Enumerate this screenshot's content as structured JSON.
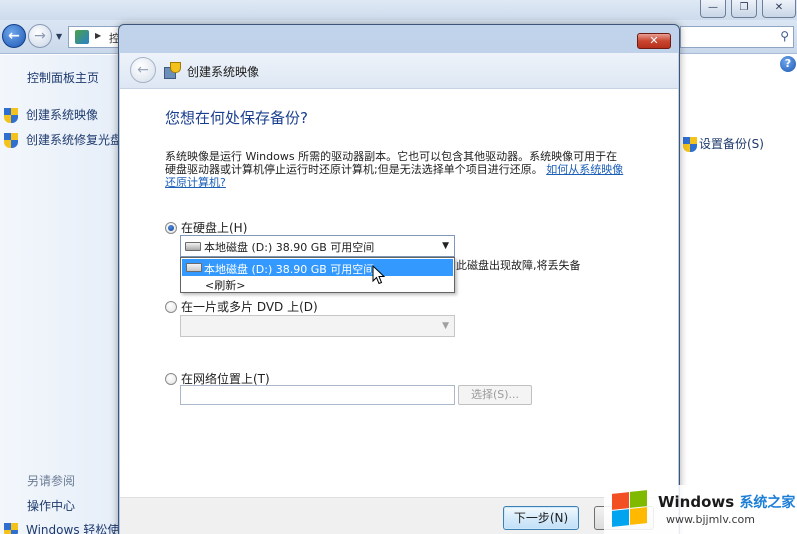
{
  "background": {
    "address_text": "控",
    "sidebar": {
      "home": "控制面板主页",
      "items": [
        "创建系统映像",
        "创建系统修复光盘"
      ],
      "see_also": "另请参阅",
      "links": [
        "操作中心",
        "Windows 轻松使"
      ]
    },
    "setup_backup": "设置备份(S)"
  },
  "dialog": {
    "title": "创建系统映像",
    "heading": "您想在何处保存备份?",
    "description": "系统映像是运行 Windows 所需的驱动器副本。它也可以包含其他驱动器。系统映像可用于在硬盘驱动器或计算机停止运行时还原计算机;但是无法选择单个项目进行还原。",
    "description_link": "如何从系统映像还原计算机?",
    "options": {
      "hard_disk": "在硬盘上(H)",
      "dvd": "在一片或多片 DVD 上(D)",
      "network": "在网络位置上(T)"
    },
    "hard_disk_selected": "本地磁盘 (D:) 38.90 GB 可用空间",
    "dropdown_options": [
      "本地磁盘 (D:) 38.90 GB 可用空间",
      "<刷新>"
    ],
    "partial_warning": "此磁盘出现故障,将丢失备",
    "select_button": "选择(S)...",
    "next_button": "下一步(N)"
  },
  "watermark": {
    "brand": "Windows",
    "brand_cn": "系统之家",
    "url": "www.bjjmlv.com"
  },
  "colors": {
    "accent_blue": "#3399ff",
    "heading_blue": "#1a3f8f",
    "link_blue": "#1c5fb7"
  }
}
